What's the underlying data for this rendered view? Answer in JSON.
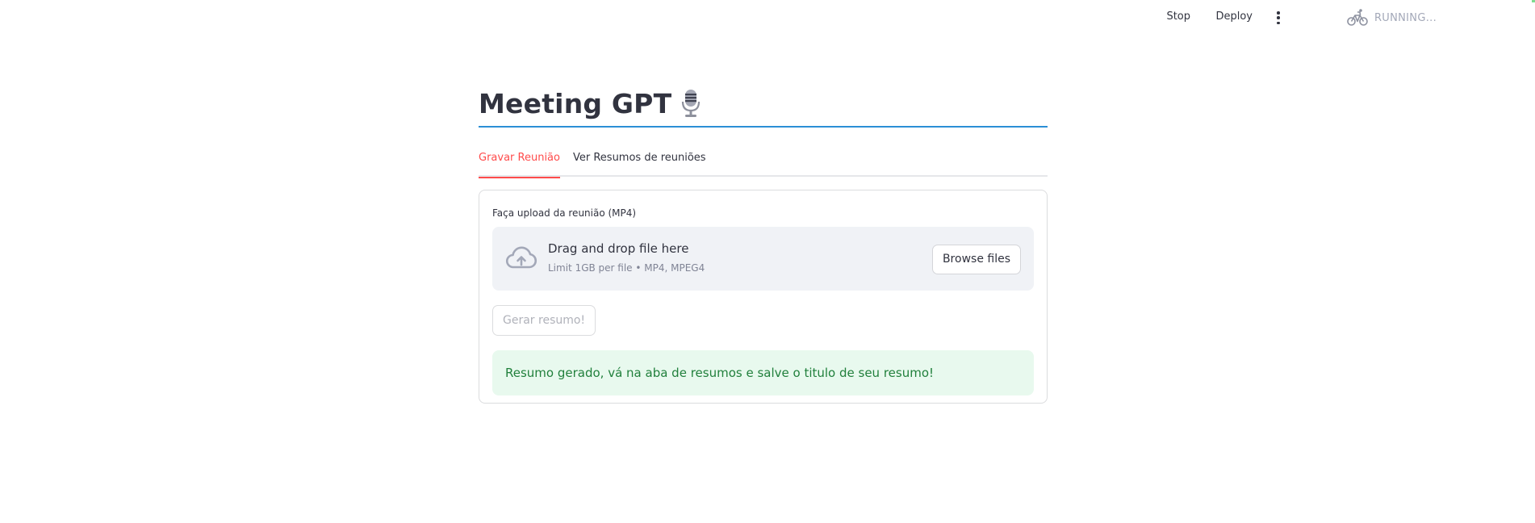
{
  "header": {
    "status": "RUNNING...",
    "stop_label": "Stop",
    "deploy_label": "Deploy",
    "status_icon": "bicycle-icon",
    "menu_icon": "vertical-dots-menu-icon"
  },
  "page": {
    "title": "Meeting GPT",
    "title_icon": "microphone-icon"
  },
  "tabs": [
    {
      "label": "Gravar Reunião",
      "active": true
    },
    {
      "label": "Ver Resumos de reuniões",
      "active": false
    }
  ],
  "uploader": {
    "label": "Faça upload da reunião (MP4)",
    "drop_text": "Drag and drop file here",
    "limit_text": "Limit 1GB per file • MP4, MPEG4",
    "browse_label": "Browse files",
    "icon": "cloud-upload-icon"
  },
  "generate_button": {
    "label": "Gerar resumo!",
    "disabled": true
  },
  "alert": {
    "message": "Resumo gerado, vá na aba de resumos e salve o titulo de seu resumo!"
  },
  "colors": {
    "accent": "#ff4b4b",
    "title_underline": "#2b8fd6",
    "success_bg": "#e8f9ee",
    "success_text": "#21803c",
    "dropzone_bg": "#f0f2f6"
  }
}
